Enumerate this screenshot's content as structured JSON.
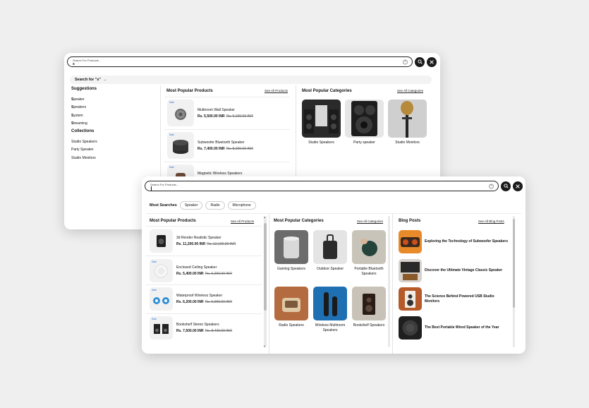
{
  "window_back": {
    "search": {
      "placeholder": "Search For Products...",
      "value": "s"
    },
    "search_for": "Search for \"s\"",
    "suggestions_title": "Suggestions",
    "suggestions": [
      {
        "bold": "S",
        "rest": "peaker"
      },
      {
        "bold": "S",
        "rest": "peakers"
      },
      {
        "bold": "S",
        "rest": "ystem"
      },
      {
        "bold": "S",
        "rest": "treaming"
      }
    ],
    "collections_title": "Collections",
    "collections": [
      "Studio Speakers",
      "Party Speaker",
      "Studio Monitors"
    ],
    "products_title": "Most Popular Products",
    "products_link": "See All Products",
    "products": [
      {
        "badge": "Sale",
        "name": "Multiroom Wall Speaker",
        "price": "Rs. 5,500.00 INR",
        "old_price": "Rs. 6,100.00 INR"
      },
      {
        "badge": "Sale",
        "name": "Subwoofer Bluetooth Speaker",
        "price": "Rs. 7,400.00 INR",
        "old_price": "Rs. 8,200.00 INR"
      },
      {
        "badge": "Sale",
        "name": "Magnetic Wireless Speakers",
        "price": "",
        "old_price": ""
      }
    ],
    "categories_title": "Most Popular Categories",
    "categories_link": "See All Categories",
    "categories": [
      "Studio Speakers",
      "Party speaker",
      "Studio Monitors"
    ]
  },
  "window_front": {
    "search": {
      "placeholder": "Search For Products...",
      "value": ""
    },
    "most_searches_title": "Most Searches",
    "chips": [
      "Speaker",
      "Radio",
      "Microphone"
    ],
    "products_title": "Most Popular Products",
    "products_link": "See All Products",
    "products": [
      {
        "badge": "",
        "name": "3d Render Realistic Speaker",
        "price": "Rs. 11,200.00 INR",
        "old_price": "Rs. 12,100.00 INR"
      },
      {
        "badge": "Sale",
        "name": "Enclosed Ceiling Speaker",
        "price": "Rs. 5,400.00 INR",
        "old_price": "Rs. 6,200.00 INR"
      },
      {
        "badge": "Sale",
        "name": "Waterproof Wireless Speaker",
        "price": "Rs. 6,200.00 INR",
        "old_price": "Rs. 6,900.00 INR"
      },
      {
        "badge": "Sale",
        "name": "Bookshelf Stereo Speakers",
        "price": "Rs. 7,500.00 INR",
        "old_price": "Rs. 8,400.00 INR"
      }
    ],
    "categories_title": "Most Popular Categories",
    "categories_link": "See All Categories",
    "categories": [
      "Gaming Speakers",
      "Outdoor Speaker",
      "Portable Bluetooth Speakers",
      "Radio Speakers",
      "Wireless Multiroom Speakers",
      "Bookshelf Speakers"
    ],
    "blog_title": "Blog Posts",
    "blog_link": "See All Blog Posts",
    "blog": [
      "Exploring the Technology of Subwoofer Speakers",
      "Discover the Ultimate Vintage Classic Speaker",
      "The Science Behind Powered USB Studio Monitors",
      "The Best Portable Wired Speaker of the Year"
    ]
  },
  "colors": {
    "sale": "#2b6fd6",
    "button": "#1b1b1b",
    "background": "#efefef"
  },
  "icons": [
    "search-icon",
    "close-icon",
    "clear-icon",
    "arrow-right-icon"
  ]
}
